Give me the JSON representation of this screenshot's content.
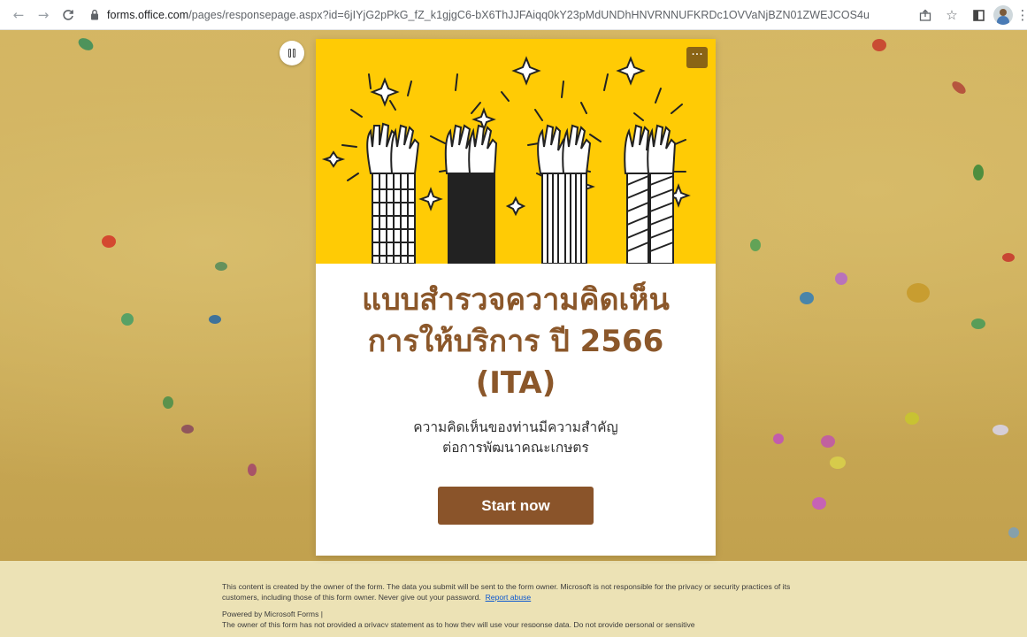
{
  "browser": {
    "url_host": "forms.office.com",
    "url_path": "/pages/responsepage.aspx?id=6jIYjG2pPkG_fZ_k1gjgC6-bX6ThJJFAiqq0kY23pMdUNDhHNVRNNUFKRDc1OVVaNjBZN01ZWEJCOS4u"
  },
  "form": {
    "title_line1": "แบบสำรวจความคิดเห็น",
    "title_line2": "การให้บริการ ปี 2566",
    "title_line3": "(ITA)",
    "subtitle_line1": "ความคิดเห็นของท่านมีความสำคัญ",
    "subtitle_line2": "ต่อการพัฒนาคณะเกษตร",
    "start_label": "Start now",
    "more_label": "···"
  },
  "footer": {
    "disclaimer": "This content is created by the owner of the form. The data you submit will be sent to the form owner. Microsoft is not responsible for the privacy or security practices of its customers, including those of this form owner. Never give out your password.",
    "report_abuse": "Report abuse",
    "powered_by": "Powered by Microsoft Forms |",
    "privacy_note": "The owner of this form has not provided a privacy statement as to how they will use your response data. Do not provide personal or sensitive"
  },
  "colors": {
    "banner": "#ffcb05",
    "title": "#8b572a",
    "button": "#8a542a",
    "background": "#c9a955"
  },
  "icons": [
    "back-arrow-icon",
    "forward-arrow-icon",
    "reload-icon",
    "lock-icon",
    "share-icon",
    "star-icon",
    "sidepanel-icon",
    "profile-avatar",
    "pause-icon",
    "more-icon"
  ]
}
